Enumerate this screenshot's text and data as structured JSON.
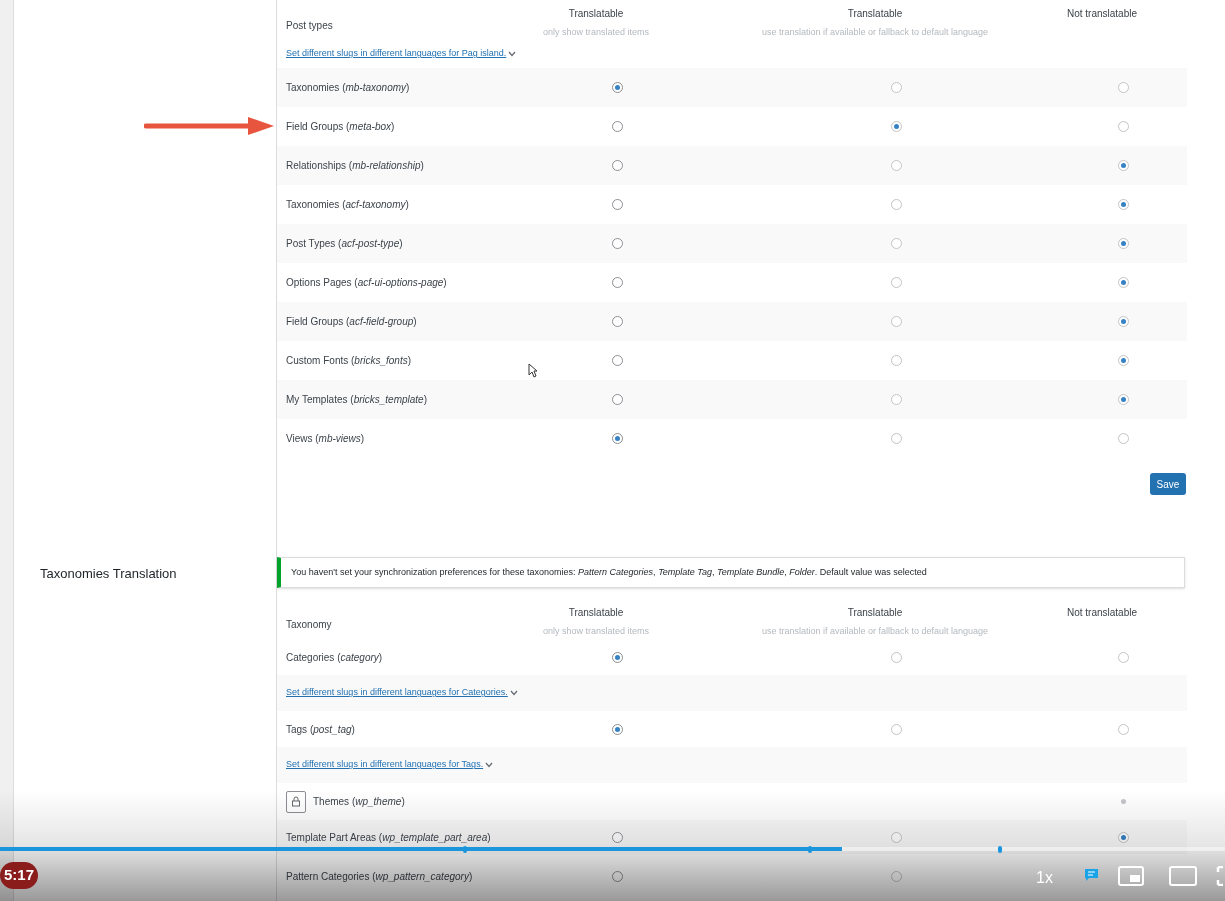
{
  "post_types": {
    "header": {
      "first": "Post types",
      "columns": [
        {
          "title": "Translatable",
          "note": "only show translated items"
        },
        {
          "title": "Translatable",
          "note": "use translation if available or fallback to default language"
        },
        {
          "title": "Not translatable"
        }
      ]
    },
    "rows": [
      {
        "kind": "slug_link",
        "text": "Set different slugs in different languages for Pag island."
      },
      {
        "kind": "radio",
        "label": "Taxonomies (*mb-taxonomy*)",
        "options": [
          {
            "selected": true
          },
          {
            "selected": false
          },
          {
            "selected": false
          }
        ]
      },
      {
        "kind": "radio",
        "label": "Field Groups (*meta-box*)",
        "options": [
          {
            "selected": false
          },
          {
            "selected": true
          },
          {
            "selected": false
          }
        ]
      },
      {
        "kind": "radio",
        "label": "Relationships (*mb-relationship*)",
        "options": [
          {
            "selected": false
          },
          {
            "selected": false
          },
          {
            "selected": true
          }
        ]
      },
      {
        "kind": "radio",
        "label": "Taxonomies (*acf-taxonomy*)",
        "options": [
          {
            "selected": false
          },
          {
            "selected": false
          },
          {
            "selected": true
          }
        ]
      },
      {
        "kind": "radio",
        "label": "Post Types (*acf-post-type*)",
        "options": [
          {
            "selected": false
          },
          {
            "selected": false
          },
          {
            "selected": true
          }
        ]
      },
      {
        "kind": "radio",
        "label": "Options Pages (*acf-ui-options-page*)",
        "options": [
          {
            "selected": false
          },
          {
            "selected": false
          },
          {
            "selected": true
          }
        ]
      },
      {
        "kind": "radio",
        "label": "Field Groups (*acf-field-group*)",
        "options": [
          {
            "selected": false
          },
          {
            "selected": false
          },
          {
            "selected": true
          }
        ]
      },
      {
        "kind": "radio",
        "label": "Custom Fonts (*bricks_fonts*)",
        "options": [
          {
            "selected": false
          },
          {
            "selected": false
          },
          {
            "selected": true
          }
        ]
      },
      {
        "kind": "radio",
        "label": "My Templates (*bricks_template*)",
        "options": [
          {
            "selected": false
          },
          {
            "selected": false
          },
          {
            "selected": true
          }
        ]
      },
      {
        "kind": "radio",
        "label": "Views (*mb-views*)",
        "options": [
          {
            "selected": true
          },
          {
            "selected": false
          },
          {
            "selected": false
          }
        ]
      }
    ],
    "save_button": "Save"
  },
  "taxonomies": {
    "section_title": "Taxonomies Translation",
    "notice": "You haven't set your synchronization preferences for these taxonomies: *Pattern Categories*, *Template Tag*, *Template Bundle*, *Folder*. Default value was selected",
    "header": {
      "first": "Taxonomy",
      "columns": [
        {
          "title": "Translatable",
          "note": "only show translated items"
        },
        {
          "title": "Translatable",
          "note": "use translation if available or fallback to default language"
        },
        {
          "title": "Not translatable"
        }
      ]
    },
    "rows": [
      {
        "kind": "radio",
        "label": "Categories (*category*)",
        "options": [
          {
            "selected": true
          },
          {
            "selected": false
          },
          {
            "selected": false
          }
        ]
      },
      {
        "kind": "slug_link",
        "text": "Set different slugs in different languages for Categories."
      },
      {
        "kind": "radio",
        "label": "Tags (*post_tag*)",
        "options": [
          {
            "selected": true
          },
          {
            "selected": false
          },
          {
            "selected": false
          }
        ]
      },
      {
        "kind": "slug_link",
        "text": "Set different slugs in different languages for Tags."
      },
      {
        "kind": "locked",
        "label": "Themes (*wp_theme*)"
      },
      {
        "kind": "radio",
        "label": "Template Part Areas (*wp_template_part_area*)",
        "options": [
          {
            "selected": false
          },
          {
            "selected": false
          },
          {
            "selected": true
          }
        ]
      },
      {
        "kind": "radio",
        "label": "Pattern Categories (*wp_pattern_category*)",
        "options": [
          {
            "selected": false
          },
          {
            "selected": false
          }
        ]
      }
    ]
  },
  "video_player": {
    "time": "5:17",
    "progress": {
      "level": 0.687
    },
    "speed": "1x"
  }
}
